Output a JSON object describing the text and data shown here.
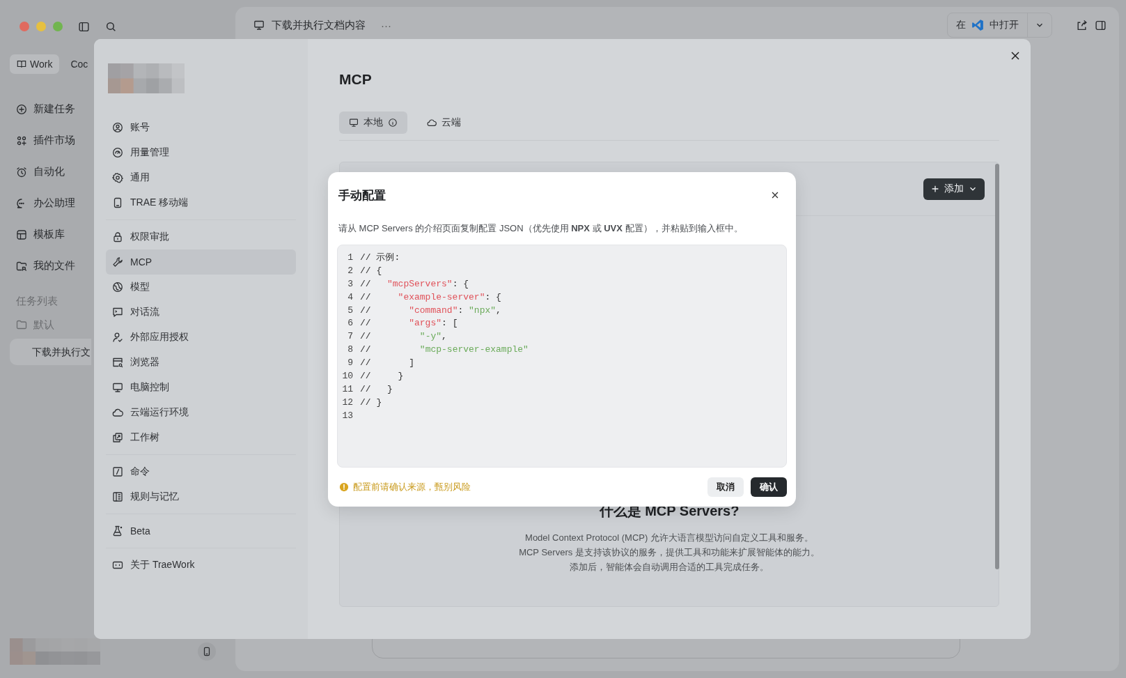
{
  "window": {
    "title": "下载并执行文档内容",
    "more": "···",
    "open_in": {
      "prefix": "在",
      "suffix": "中打开"
    }
  },
  "sidebar": {
    "tabs": [
      {
        "label": "Work",
        "selected": true
      },
      {
        "label": "Coc",
        "selected": false
      }
    ],
    "items": [
      {
        "label": "新建任务"
      },
      {
        "label": "插件市场"
      },
      {
        "label": "自动化"
      },
      {
        "label": "办公助理"
      },
      {
        "label": "模板库"
      },
      {
        "label": "我的文件"
      }
    ],
    "section_title": "任务列表",
    "folders": [
      {
        "label": "默认",
        "tasks": [
          {
            "label": "下载并执行文",
            "selected": true
          }
        ]
      }
    ]
  },
  "settings": {
    "menu_groups": [
      [
        {
          "label": "账号",
          "selected": false
        },
        {
          "label": "用量管理",
          "selected": false
        },
        {
          "label": "通用",
          "selected": false
        },
        {
          "label": "TRAE 移动端",
          "selected": false
        }
      ],
      [
        {
          "label": "权限审批",
          "selected": false
        },
        {
          "label": "MCP",
          "selected": true
        },
        {
          "label": "模型",
          "selected": false
        },
        {
          "label": "对话流",
          "selected": false
        },
        {
          "label": "外部应用授权",
          "selected": false
        },
        {
          "label": "浏览器",
          "selected": false
        },
        {
          "label": "电脑控制",
          "selected": false
        },
        {
          "label": "云端运行环境",
          "selected": false
        },
        {
          "label": "工作树",
          "selected": false
        }
      ],
      [
        {
          "label": "命令",
          "selected": false
        },
        {
          "label": "规则与记忆",
          "selected": false
        }
      ],
      [
        {
          "label": "Beta",
          "selected": false
        }
      ],
      [
        {
          "label": "关于 TraeWork",
          "selected": false
        }
      ]
    ],
    "page": {
      "title": "MCP",
      "tabs": [
        {
          "label": "本地",
          "selected": true
        },
        {
          "label": "云端",
          "selected": false
        }
      ],
      "add_button": "添加",
      "intro": {
        "title": "什么是 MCP Servers?",
        "lines": [
          "Model Context Protocol (MCP) 允许大语言模型访问自定义工具和服务。",
          "MCP Servers 是支持该协议的服务，提供工具和功能来扩展智能体的能力。",
          "添加后，智能体会自动调用合适的工具完成任务。"
        ]
      }
    }
  },
  "dialog": {
    "title": "手动配置",
    "description": "请从 MCP Servers 的介绍页面复制配置 JSON（优先使用 **NPX** 或 **UVX** 配置），并粘贴到输入框中。",
    "code": [
      {
        "number": "1",
        "tokens": [
          {
            "kind": "plain",
            "text": "// 示例:"
          }
        ]
      },
      {
        "number": "2",
        "tokens": [
          {
            "kind": "plain",
            "text": "// {"
          }
        ]
      },
      {
        "number": "3",
        "tokens": [
          {
            "kind": "plain",
            "text": "//   "
          },
          {
            "kind": "key",
            "text": "\"mcpServers\""
          },
          {
            "kind": "plain",
            "text": ": {"
          }
        ]
      },
      {
        "number": "4",
        "tokens": [
          {
            "kind": "plain",
            "text": "//     "
          },
          {
            "kind": "key",
            "text": "\"example-server\""
          },
          {
            "kind": "plain",
            "text": ": {"
          }
        ]
      },
      {
        "number": "5",
        "tokens": [
          {
            "kind": "plain",
            "text": "//       "
          },
          {
            "kind": "key",
            "text": "\"command\""
          },
          {
            "kind": "plain",
            "text": ": "
          },
          {
            "kind": "string",
            "text": "\"npx\""
          },
          {
            "kind": "plain",
            "text": ","
          }
        ]
      },
      {
        "number": "6",
        "tokens": [
          {
            "kind": "plain",
            "text": "//       "
          },
          {
            "kind": "key",
            "text": "\"args\""
          },
          {
            "kind": "plain",
            "text": ": ["
          }
        ]
      },
      {
        "number": "7",
        "tokens": [
          {
            "kind": "plain",
            "text": "//         "
          },
          {
            "kind": "string",
            "text": "\"-y\""
          },
          {
            "kind": "plain",
            "text": ","
          }
        ]
      },
      {
        "number": "8",
        "tokens": [
          {
            "kind": "plain",
            "text": "//         "
          },
          {
            "kind": "string",
            "text": "\"mcp-server-example\""
          }
        ]
      },
      {
        "number": "9",
        "tokens": [
          {
            "kind": "plain",
            "text": "//       ]"
          }
        ]
      },
      {
        "number": "10",
        "tokens": [
          {
            "kind": "plain",
            "text": "//     }"
          }
        ]
      },
      {
        "number": "11",
        "tokens": [
          {
            "kind": "plain",
            "text": "//   }"
          }
        ]
      },
      {
        "number": "12",
        "tokens": [
          {
            "kind": "plain",
            "text": "// }"
          }
        ]
      },
      {
        "number": "13"
      }
    ],
    "warning": "配置前请确认来源，甄别风险",
    "cancel": "取消",
    "confirm": "确认"
  }
}
